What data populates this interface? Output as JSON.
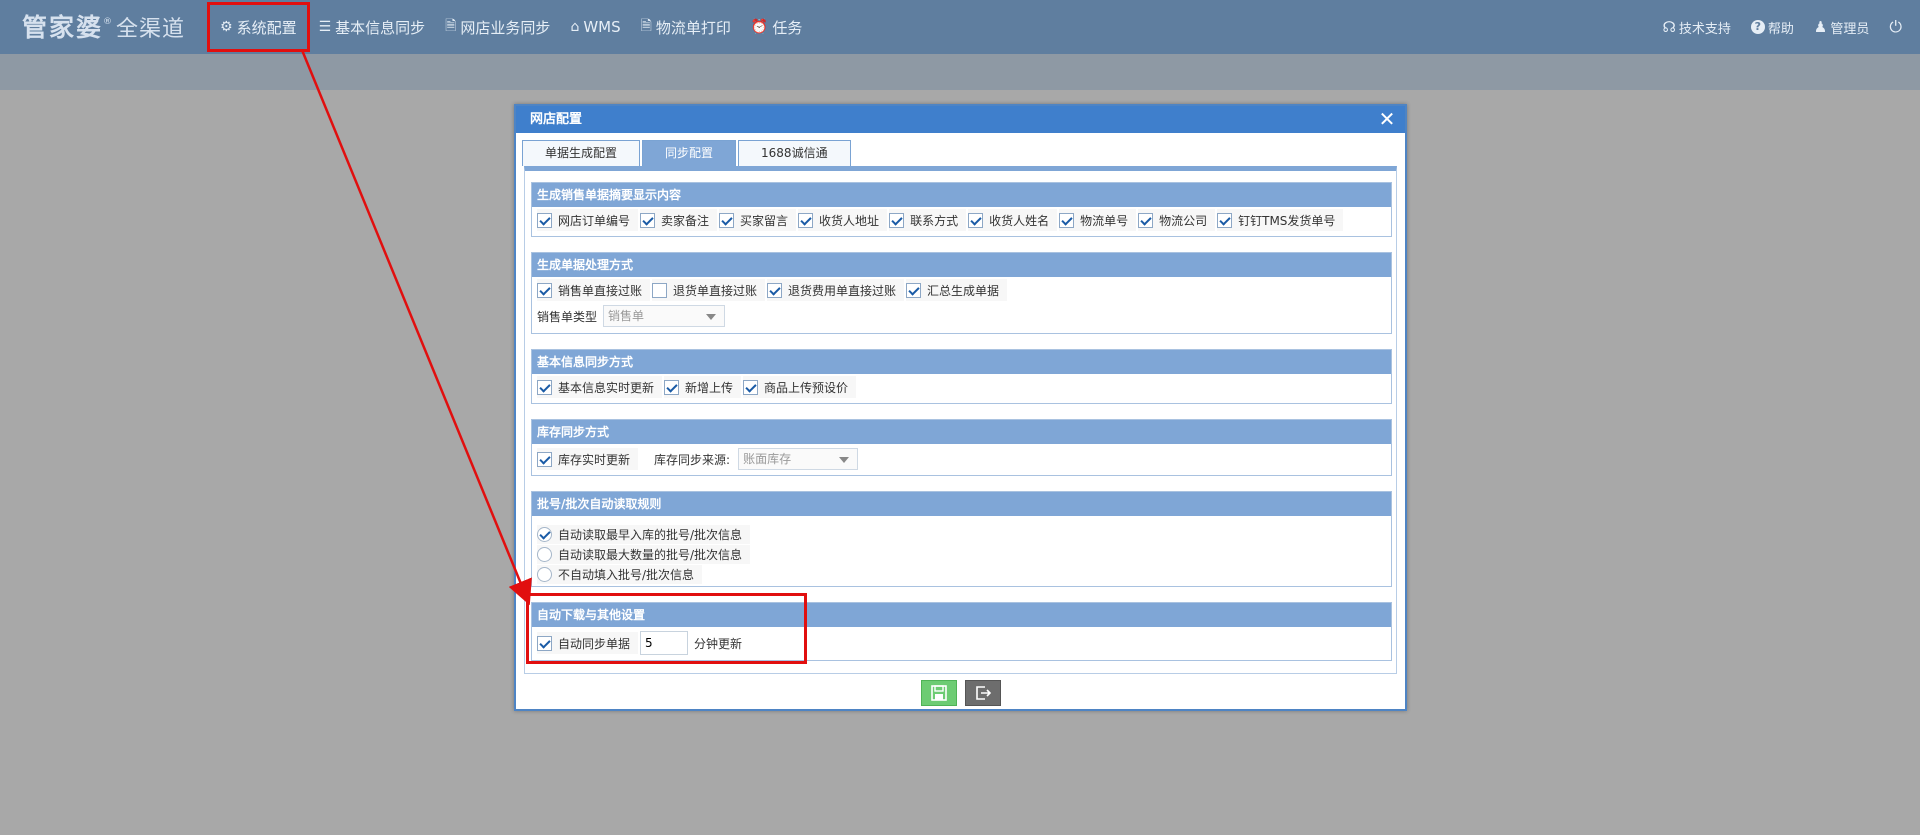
{
  "header": {
    "logo_main": "管家婆",
    "logo_reg": "®",
    "logo_sub": "全渠道",
    "nav": [
      {
        "label": "系统配置",
        "icon": "gear-icon",
        "glyph": "⚙"
      },
      {
        "label": "基本信息同步",
        "icon": "list-icon",
        "glyph": "☰"
      },
      {
        "label": "网店业务同步",
        "icon": "document-icon",
        "glyph": "🗎"
      },
      {
        "label": "WMS",
        "icon": "warehouse-icon",
        "glyph": "⌂"
      },
      {
        "label": "物流单打印",
        "icon": "print-doc-icon",
        "glyph": "🗎"
      },
      {
        "label": "任务",
        "icon": "alarm-clock-icon",
        "glyph": "⏰"
      }
    ],
    "right": [
      {
        "label": "技术支持",
        "icon": "headset-icon",
        "glyph": "☊"
      },
      {
        "label": "帮助",
        "icon": "help-icon",
        "glyph": "?"
      },
      {
        "label": "管理员",
        "icon": "user-icon",
        "glyph": "♟"
      }
    ],
    "power_glyph": "⏻"
  },
  "dialog": {
    "title": "网店配置",
    "close_glyph": "✕",
    "tabs": [
      "单据生成配置",
      "同步配置",
      "1688诚信通"
    ],
    "active_tab": 1,
    "sections": {
      "summary": {
        "title": "生成销售单据摘要显示内容",
        "options": [
          {
            "label": "网店订单编号",
            "checked": true
          },
          {
            "label": "卖家备注",
            "checked": true
          },
          {
            "label": "买家留言",
            "checked": true
          },
          {
            "label": "收货人地址",
            "checked": true
          },
          {
            "label": "联系方式",
            "checked": true
          },
          {
            "label": "收货人姓名",
            "checked": true
          },
          {
            "label": "物流单号",
            "checked": true
          },
          {
            "label": "物流公司",
            "checked": true
          },
          {
            "label": "钉钉TMS发货单号",
            "checked": true
          }
        ]
      },
      "process": {
        "title": "生成单据处理方式",
        "options": [
          {
            "label": "销售单直接过账",
            "checked": true
          },
          {
            "label": "退货单直接过账",
            "checked": false
          },
          {
            "label": "退货费用单直接过账",
            "checked": true
          },
          {
            "label": "汇总生成单据",
            "checked": true
          }
        ],
        "sale_type_label": "销售单类型",
        "sale_type_value": "销售单"
      },
      "basic": {
        "title": "基本信息同步方式",
        "options": [
          {
            "label": "基本信息实时更新",
            "checked": true
          },
          {
            "label": "新增上传",
            "checked": true
          },
          {
            "label": "商品上传预设价",
            "checked": true
          }
        ]
      },
      "stock": {
        "title": "库存同步方式",
        "realtime_label": "库存实时更新",
        "realtime_checked": true,
        "source_label": "库存同步来源:",
        "source_value": "账面库存"
      },
      "batch": {
        "title": "批号/批次自动读取规则",
        "options": [
          {
            "label": "自动读取最早入库的批号/批次信息",
            "checked": true
          },
          {
            "label": "自动读取最大数量的批号/批次信息",
            "checked": false
          },
          {
            "label": "不自动填入批号/批次信息",
            "checked": false
          }
        ]
      },
      "auto": {
        "title": "自动下载与其他设置",
        "sync_label": "自动同步单据",
        "sync_checked": true,
        "minutes": "5",
        "minutes_suffix": "分钟更新"
      }
    }
  },
  "colors": {
    "highlight": "#e10f0f",
    "title_bar": "#3f7fcc",
    "section_head": "#7fa6d6",
    "save": "#6dcc73",
    "exit": "#6d6d6d"
  }
}
